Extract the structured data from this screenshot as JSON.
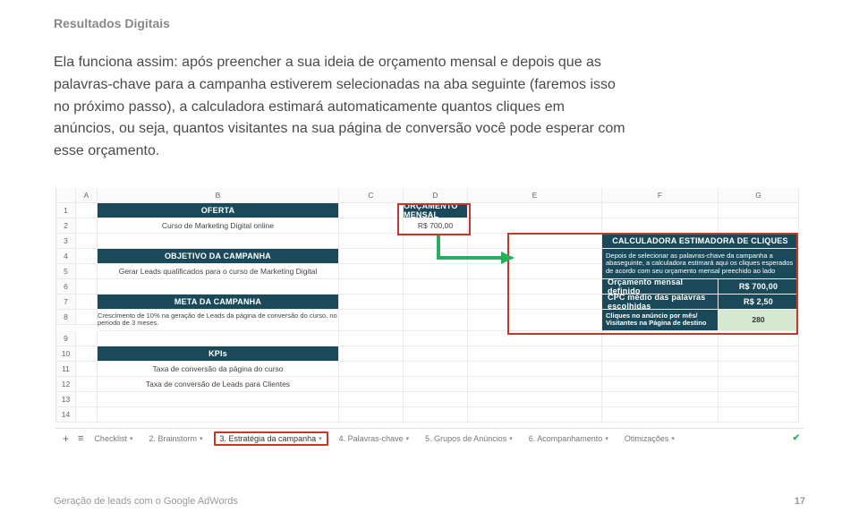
{
  "brand": "Resultados Digitais",
  "body": "Ela funciona assim: após preencher a sua ideia de orçamento mensal e depois que as palavras-chave para a campanha estiverem selecionadas na aba seguinte (faremos isso no próximo passo), a calculadora estimará automaticamente quantos cliques em anúncios, ou seja, quantos visitantes na sua página de conversão você pode esperar com esse orçamento.",
  "columns": {
    "A": "A",
    "B": "B",
    "C": "C",
    "D": "D",
    "E": "E",
    "F": "F",
    "G": "G"
  },
  "rows": [
    "1",
    "2",
    "3",
    "4",
    "5",
    "6",
    "7",
    "8",
    "9",
    "10",
    "11",
    "12",
    "13",
    "14"
  ],
  "sheet": {
    "oferta_hdr": "OFERTA",
    "oferta_val": "Curso de Marketing Digital online",
    "orc_hdr": "ORÇAMENTO MENSAL",
    "orc_val": "R$ 700,00",
    "obj_hdr": "OBJETIVO DA CAMPANHA",
    "obj_val": "Gerar Leads qualificados para o curso de Marketing Digital",
    "meta_hdr": "META DA CAMPANHA",
    "meta_val": "Crescimento de 10% na geração de Leads da página de conversão do curso, no período de 3 meses.",
    "kpi_hdr": "KPIs",
    "kpi1": "Taxa de conversão da página do curso",
    "kpi2": "Taxa de conversão de Leads para Clientes",
    "calc_hdr": "CALCULADORA ESTIMADORA DE CLIQUES",
    "calc_desc": "Depois de selecionar as palavras-chave da campanha a abaseguinte, a calculadora estimará aqui os cliques esperados de acordo com seu orçamento mensal preechido ao lado",
    "row_orc_label": "Orçamento mensal definido",
    "row_orc_val": "R$ 700,00",
    "row_cpc_label": "CPC médio das palavras escolhidas",
    "row_cpc_val": "R$ 2,50",
    "row_clicks_label": "Cliques no anúncio por mês/ Visitantes na Página de destino",
    "row_clicks_val": "280"
  },
  "tabs": {
    "t1": "Checklist",
    "t2": "2. Brainstorm",
    "t3": "3. Estratégia da campanha",
    "t4": "4. Palavras-chave",
    "t5": "5. Grupos de Anúncios",
    "t6": "6. Acompanhamento",
    "t7": "Otimizações"
  },
  "footer": {
    "left": "Geração de leads com o Google AdWords",
    "right": "17"
  }
}
